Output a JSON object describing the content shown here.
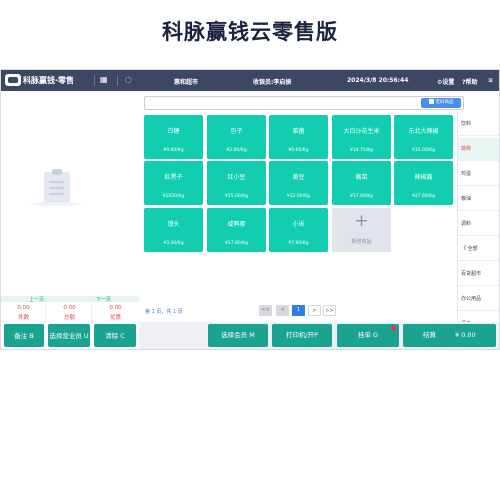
{
  "page_title": "科脉赢钱云零售版",
  "topbar": {
    "brand": "科脉赢钱·零售",
    "store": "惠和超市",
    "cashier": "收银员:李启振",
    "datetime": "2024/3/8 20:56:44",
    "settings_label": "设置",
    "help_label": "帮助"
  },
  "search": {
    "placeholder": "",
    "barcode_button": "无码商品"
  },
  "products": [
    {
      "name": "白糖",
      "price": "¥9.00/Kg"
    },
    {
      "name": "包子",
      "price": "¥2.00/Kg"
    },
    {
      "name": "菜菌",
      "price": "¥0.66/Kg"
    },
    {
      "name": "大白沙花生米",
      "price": "¥14.75/Kg"
    },
    {
      "name": "东北大辣椒",
      "price": "¥15.00/Kg"
    },
    {
      "name": "豇黑子",
      "price": "¥1020/Kg"
    },
    {
      "name": "红小豆",
      "price": "¥15.00/Kg"
    },
    {
      "name": "黄豆",
      "price": "¥12.00/Kg"
    },
    {
      "name": "酱菜",
      "price": "¥17.00/Kg"
    },
    {
      "name": "辣椒酱",
      "price": "¥27.60/Kg"
    },
    {
      "name": "馒头",
      "price": "¥3.36/Kg"
    },
    {
      "name": "咸鸭蛋",
      "price": "¥17.80/Kg"
    },
    {
      "name": "小米",
      "price": "¥7.90/Kg"
    }
  ],
  "add_product_label": "新增商品",
  "categories": [
    {
      "label": "饮料",
      "active": false
    },
    {
      "label": "蔬称",
      "active": true
    },
    {
      "label": "鸡蛋",
      "active": false
    },
    {
      "label": "粮油",
      "active": false
    },
    {
      "label": "调料",
      "active": false
    },
    {
      "label": "《 全部",
      "active": false
    },
    {
      "label": "百货超市",
      "active": false
    },
    {
      "label": "办公用品",
      "active": false
    },
    {
      "label": "酒食",
      "active": false
    }
  ],
  "pagination": {
    "info": "第 1 页，共 1 页",
    "first": "<<",
    "prev": "<",
    "current": "1",
    "next": ">",
    "last": ">>"
  },
  "left_pager": {
    "prev": "上一页",
    "next": "下一页"
  },
  "stats": [
    {
      "value": "0.00",
      "label": "件数"
    },
    {
      "value": "0.00",
      "label": "总额"
    },
    {
      "value": "0.00",
      "label": "优惠"
    }
  ],
  "left_buttons": {
    "remark": "备注 B",
    "salesperson": "选择营业员 U",
    "clear": "清除 C"
  },
  "bottom_buttons": {
    "member": "选择会员 M",
    "print": "打印机/开P",
    "hold": "挂单 G",
    "checkout": "结算",
    "total": "¥ 0.00"
  },
  "colors": {
    "accent": "#12cdb0",
    "button": "#1aa38e",
    "topbar": "#3c4764",
    "negative": "#e24848",
    "highlight": "#2e7ce6"
  }
}
